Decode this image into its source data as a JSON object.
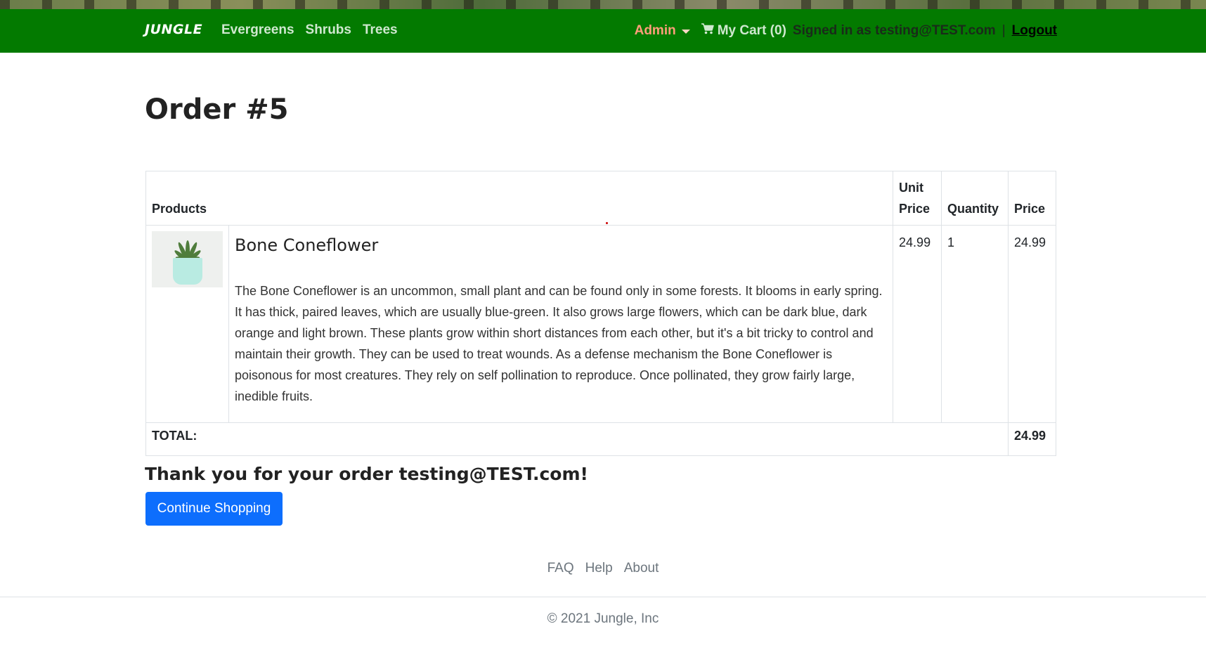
{
  "nav": {
    "brand": "JUNGLE",
    "links": [
      "Evergreens",
      "Shrubs",
      "Trees"
    ],
    "admin_label": "Admin",
    "cart_label": "My Cart (0)",
    "signed_in_text": "Signed in as testing@TEST.com",
    "separator": "|",
    "logout_label": "Logout"
  },
  "page": {
    "title": "Order #5"
  },
  "table": {
    "headers": {
      "products": "Products",
      "unit_price_line1": "Unit",
      "unit_price_line2": "Price",
      "quantity": "Quantity",
      "price": "Price"
    },
    "rows": [
      {
        "name": "Bone Coneflower",
        "description": "The Bone Coneflower is an uncommon, small plant and can be found only in some forests. It blooms in early spring. It has thick, paired leaves, which are usually blue-green. It also grows large flowers, which can be dark blue, dark orange and light brown. These plants grow within short distances from each other, but it's a bit tricky to control and maintain their growth. They can be used to treat wounds. As a defense mechanism the Bone Coneflower is poisonous for most creatures. They rely on self pollination to reproduce. Once pollinated, they grow fairly large, inedible fruits.",
        "unit_price": "24.99",
        "quantity": "1",
        "price": "24.99",
        "image_icon": "potted-succulent-image"
      }
    ],
    "total_label": "TOTAL:",
    "total_value": "24.99"
  },
  "thanks_message": "Thank you for your order testing@TEST.com!",
  "continue_button": "Continue Shopping",
  "footer": {
    "links": [
      "FAQ",
      "Help",
      "About"
    ],
    "copyright": "© 2021 Jungle, Inc"
  },
  "colors": {
    "navbar": "#037a00",
    "admin": "#ff9e7a",
    "primary_button": "#0d6efd"
  }
}
